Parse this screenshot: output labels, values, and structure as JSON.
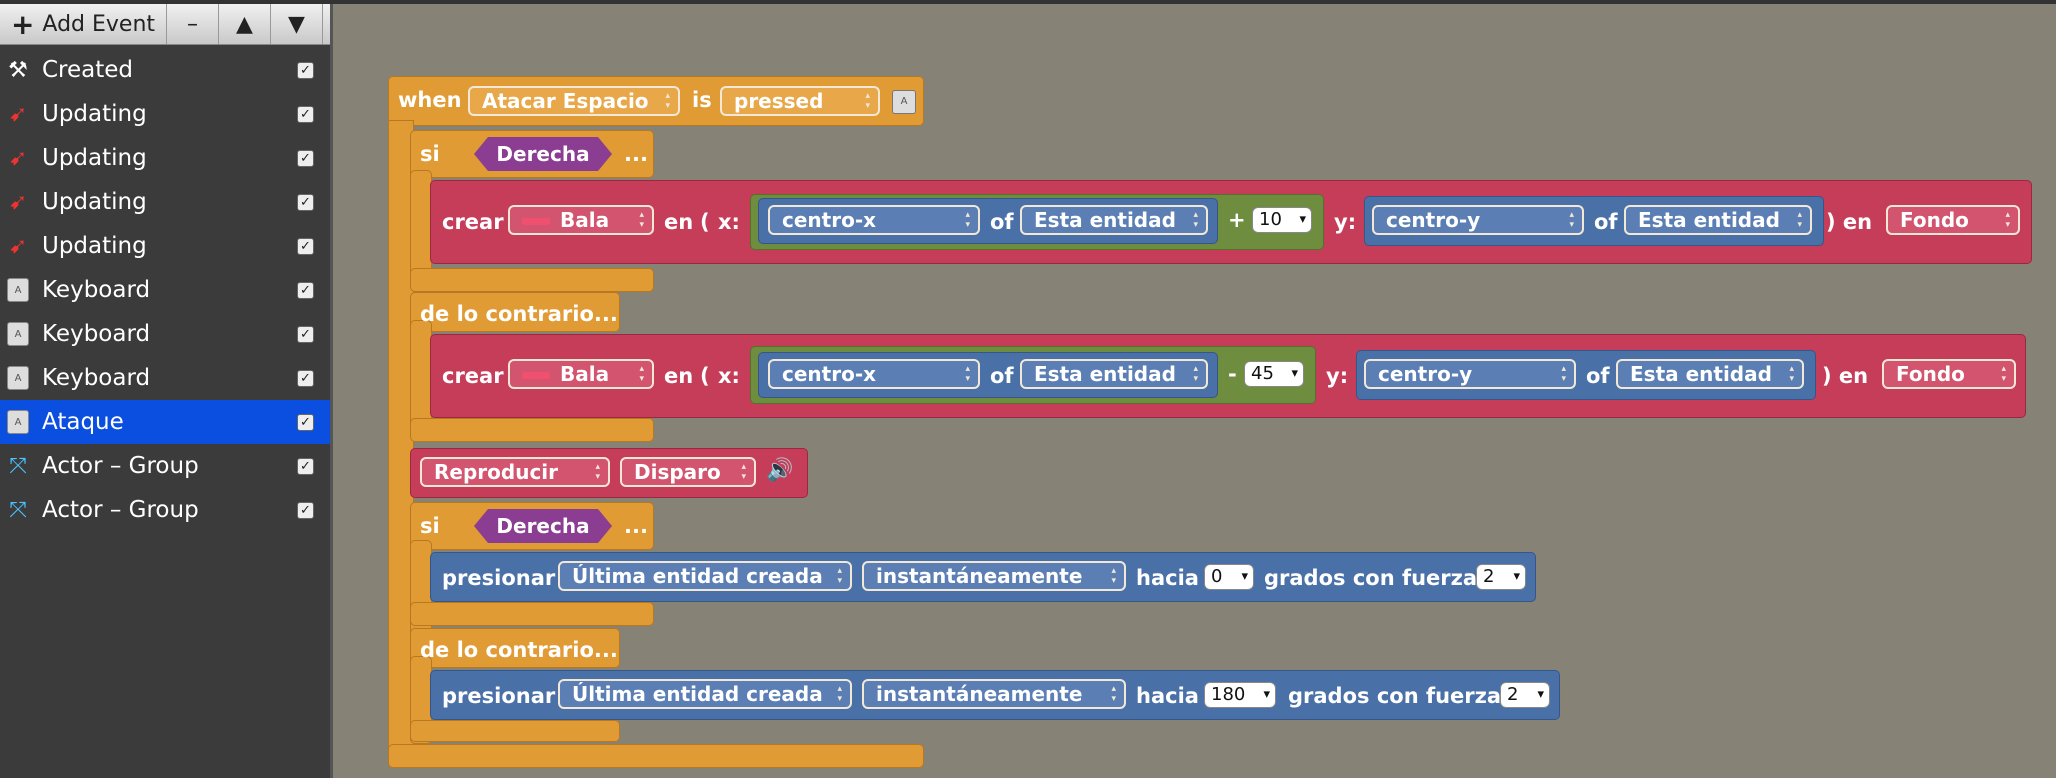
{
  "toolbar": {
    "add_label": "Add Event",
    "remove": "–",
    "up": "▲",
    "down": "▼"
  },
  "events": [
    {
      "label": "Created",
      "icon": "hammer-icon",
      "checked": true
    },
    {
      "label": "Updating",
      "icon": "update-icon",
      "checked": true
    },
    {
      "label": "Updating",
      "icon": "update-icon",
      "checked": true
    },
    {
      "label": "Updating",
      "icon": "update-icon",
      "checked": true
    },
    {
      "label": "Updating",
      "icon": "update-icon",
      "checked": true
    },
    {
      "label": "Keyboard",
      "icon": "keyboard-key-icon",
      "checked": true
    },
    {
      "label": "Keyboard",
      "icon": "keyboard-key-icon",
      "checked": true
    },
    {
      "label": "Keyboard",
      "icon": "keyboard-key-icon",
      "checked": true
    },
    {
      "label": "Ataque",
      "icon": "keyboard-key-icon",
      "checked": true,
      "selected": true
    },
    {
      "label": "Actor – Group",
      "icon": "collide-arrows-icon",
      "checked": true
    },
    {
      "label": "Actor – Group",
      "icon": "collide-arrows-icon",
      "checked": true
    }
  ],
  "script": {
    "when": "when",
    "key": "Atacar Espacio",
    "is": "is",
    "state": "pressed",
    "if1": {
      "si": "si",
      "cond": "Derecha",
      "more": "..."
    },
    "create1": {
      "crear": "crear",
      "actor": "Bala",
      "en": "en",
      "paren": "(",
      "x": "x:",
      "xattr": "centro-x",
      "of": "of",
      "entity": "Esta entidad",
      "op": "+",
      "offset": "10",
      "y": "y:",
      "yattr": "centro-y",
      "of2": "of",
      "entity2": "Esta entidad",
      "close": ") en",
      "layer": "Fondo"
    },
    "else1": "de lo contrario...",
    "create2": {
      "crear": "crear",
      "actor": "Bala",
      "en": "en",
      "paren": "(",
      "x": "x:",
      "xattr": "centro-x",
      "of": "of",
      "entity": "Esta entidad",
      "op": "-",
      "offset": "45",
      "y": "y:",
      "yattr": "centro-y",
      "of2": "of",
      "entity2": "Esta entidad",
      "close": ") en",
      "layer": "Fondo"
    },
    "play": {
      "action": "Reproducir",
      "sound": "Disparo"
    },
    "if2": {
      "si": "si",
      "cond": "Derecha",
      "more": "..."
    },
    "push1": {
      "verb": "presionar",
      "target": "Última entidad creada",
      "mode": "instantáneamente",
      "toward": "hacia",
      "angle": "0",
      "deg": "grados con fuerza",
      "force": "2"
    },
    "else2": "de lo contrario...",
    "push2": {
      "verb": "presionar",
      "target": "Última entidad creada",
      "mode": "instantáneamente",
      "toward": "hacia",
      "angle": "180",
      "deg": "grados con fuerza",
      "force": "2"
    }
  },
  "colors": {
    "canvas": "#868376",
    "event_block": "#e09b34",
    "create_block": "#c63d5a",
    "push_block": "#4a70a8",
    "math_block": "#6f8d3e",
    "condition": "#8b3d91",
    "selection": "#0b4fe0"
  }
}
